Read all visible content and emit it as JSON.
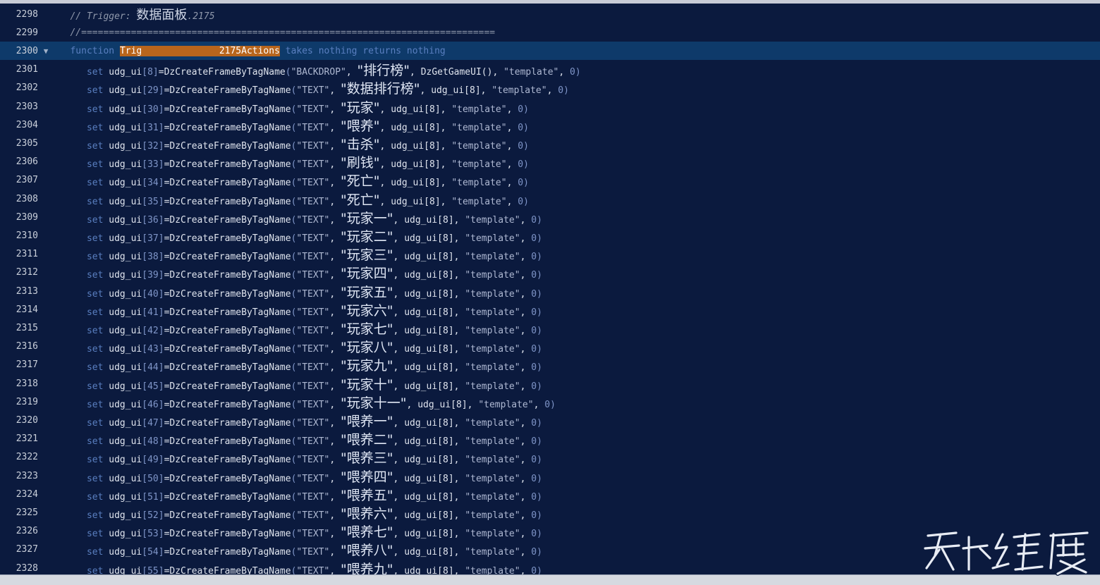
{
  "editor": {
    "lines": [
      {
        "n": "2298",
        "kind": "comment",
        "text": "// Trigger: ",
        "cjk": "数据面板",
        "tail": ".2175"
      },
      {
        "n": "2299",
        "kind": "rule",
        "text": "//==========================================================================="
      },
      {
        "n": "2300",
        "kind": "function",
        "kw": "function",
        "name": "Trig",
        "name_hl": "              2175Actions",
        "rest": " takes nothing returns nothing",
        "fold": "▼"
      },
      {
        "n": "2301",
        "kind": "set",
        "idx": "8",
        "tag": "\"BACKDROP\"",
        "label": "排行榜",
        "parent": "DzGetGameUI()",
        "tpl": "\"template\"",
        "z": "0"
      },
      {
        "n": "2302",
        "kind": "set",
        "idx": "29",
        "tag": "\"TEXT\"",
        "label": "数据排行榜",
        "parent": "udg_ui[8]",
        "tpl": "\"template\"",
        "z": "0"
      },
      {
        "n": "2303",
        "kind": "set",
        "idx": "30",
        "tag": "\"TEXT\"",
        "label": "玩家",
        "parent": "udg_ui[8]",
        "tpl": "\"template\"",
        "z": "0"
      },
      {
        "n": "2304",
        "kind": "set",
        "idx": "31",
        "tag": "\"TEXT\"",
        "label": "喂养",
        "parent": "udg_ui[8]",
        "tpl": "\"template\"",
        "z": "0"
      },
      {
        "n": "2305",
        "kind": "set",
        "idx": "32",
        "tag": "\"TEXT\"",
        "label": "击杀",
        "parent": "udg_ui[8]",
        "tpl": "\"template\"",
        "z": "0"
      },
      {
        "n": "2306",
        "kind": "set",
        "idx": "33",
        "tag": "\"TEXT\"",
        "label": "刷钱",
        "parent": "udg_ui[8]",
        "tpl": "\"template\"",
        "z": "0"
      },
      {
        "n": "2307",
        "kind": "set",
        "idx": "34",
        "tag": "\"TEXT\"",
        "label": "死亡",
        "parent": "udg_ui[8]",
        "tpl": "\"template\"",
        "z": "0"
      },
      {
        "n": "2308",
        "kind": "set",
        "idx": "35",
        "tag": "\"TEXT\"",
        "label": "死亡",
        "parent": "udg_ui[8]",
        "tpl": "\"template\"",
        "z": "0"
      },
      {
        "n": "2309",
        "kind": "set",
        "idx": "36",
        "tag": "\"TEXT\"",
        "label": "玩家一",
        "parent": "udg_ui[8]",
        "tpl": "\"template\"",
        "z": "0"
      },
      {
        "n": "2310",
        "kind": "set",
        "idx": "37",
        "tag": "\"TEXT\"",
        "label": "玩家二",
        "parent": "udg_ui[8]",
        "tpl": "\"template\"",
        "z": "0"
      },
      {
        "n": "2311",
        "kind": "set",
        "idx": "38",
        "tag": "\"TEXT\"",
        "label": "玩家三",
        "parent": "udg_ui[8]",
        "tpl": "\"template\"",
        "z": "0"
      },
      {
        "n": "2312",
        "kind": "set",
        "idx": "39",
        "tag": "\"TEXT\"",
        "label": "玩家四",
        "parent": "udg_ui[8]",
        "tpl": "\"template\"",
        "z": "0"
      },
      {
        "n": "2313",
        "kind": "set",
        "idx": "40",
        "tag": "\"TEXT\"",
        "label": "玩家五",
        "parent": "udg_ui[8]",
        "tpl": "\"template\"",
        "z": "0"
      },
      {
        "n": "2314",
        "kind": "set",
        "idx": "41",
        "tag": "\"TEXT\"",
        "label": "玩家六",
        "parent": "udg_ui[8]",
        "tpl": "\"template\"",
        "z": "0"
      },
      {
        "n": "2315",
        "kind": "set",
        "idx": "42",
        "tag": "\"TEXT\"",
        "label": "玩家七",
        "parent": "udg_ui[8]",
        "tpl": "\"template\"",
        "z": "0"
      },
      {
        "n": "2316",
        "kind": "set",
        "idx": "43",
        "tag": "\"TEXT\"",
        "label": "玩家八",
        "parent": "udg_ui[8]",
        "tpl": "\"template\"",
        "z": "0"
      },
      {
        "n": "2317",
        "kind": "set",
        "idx": "44",
        "tag": "\"TEXT\"",
        "label": "玩家九",
        "parent": "udg_ui[8]",
        "tpl": "\"template\"",
        "z": "0"
      },
      {
        "n": "2318",
        "kind": "set",
        "idx": "45",
        "tag": "\"TEXT\"",
        "label": "玩家十",
        "parent": "udg_ui[8]",
        "tpl": "\"template\"",
        "z": "0"
      },
      {
        "n": "2319",
        "kind": "set",
        "idx": "46",
        "tag": "\"TEXT\"",
        "label": "玩家十一",
        "parent": "udg_ui[8]",
        "tpl": "\"template\"",
        "z": "0"
      },
      {
        "n": "2320",
        "kind": "set",
        "idx": "47",
        "tag": "\"TEXT\"",
        "label": "喂养一",
        "parent": "udg_ui[8]",
        "tpl": "\"template\"",
        "z": "0"
      },
      {
        "n": "2321",
        "kind": "set",
        "idx": "48",
        "tag": "\"TEXT\"",
        "label": "喂养二",
        "parent": "udg_ui[8]",
        "tpl": "\"template\"",
        "z": "0"
      },
      {
        "n": "2322",
        "kind": "set",
        "idx": "49",
        "tag": "\"TEXT\"",
        "label": "喂养三",
        "parent": "udg_ui[8]",
        "tpl": "\"template\"",
        "z": "0"
      },
      {
        "n": "2323",
        "kind": "set",
        "idx": "50",
        "tag": "\"TEXT\"",
        "label": "喂养四",
        "parent": "udg_ui[8]",
        "tpl": "\"template\"",
        "z": "0"
      },
      {
        "n": "2324",
        "kind": "set",
        "idx": "51",
        "tag": "\"TEXT\"",
        "label": "喂养五",
        "parent": "udg_ui[8]",
        "tpl": "\"template\"",
        "z": "0"
      },
      {
        "n": "2325",
        "kind": "set",
        "idx": "52",
        "tag": "\"TEXT\"",
        "label": "喂养六",
        "parent": "udg_ui[8]",
        "tpl": "\"template\"",
        "z": "0"
      },
      {
        "n": "2326",
        "kind": "set",
        "idx": "53",
        "tag": "\"TEXT\"",
        "label": "喂养七",
        "parent": "udg_ui[8]",
        "tpl": "\"template\"",
        "z": "0"
      },
      {
        "n": "2327",
        "kind": "set",
        "idx": "54",
        "tag": "\"TEXT\"",
        "label": "喂养八",
        "parent": "udg_ui[8]",
        "tpl": "\"template\"",
        "z": "0"
      },
      {
        "n": "2328",
        "kind": "set",
        "idx": "55",
        "tag": "\"TEXT\"",
        "label": "喂养九",
        "parent": "udg_ui[8]",
        "tpl": "\"template\"",
        "z": "0"
      }
    ],
    "set_kw": "set",
    "var_name": "udg_ui",
    "fn_call": "DzCreateFrameByTagName",
    "current_line": "2300"
  },
  "watermark": {
    "text": "天下维度"
  },
  "colors": {
    "background": "#0b1a3e",
    "current_line": "#0e3a6a",
    "highlight": "#b8651c",
    "keyword": "#5a7fc0"
  }
}
